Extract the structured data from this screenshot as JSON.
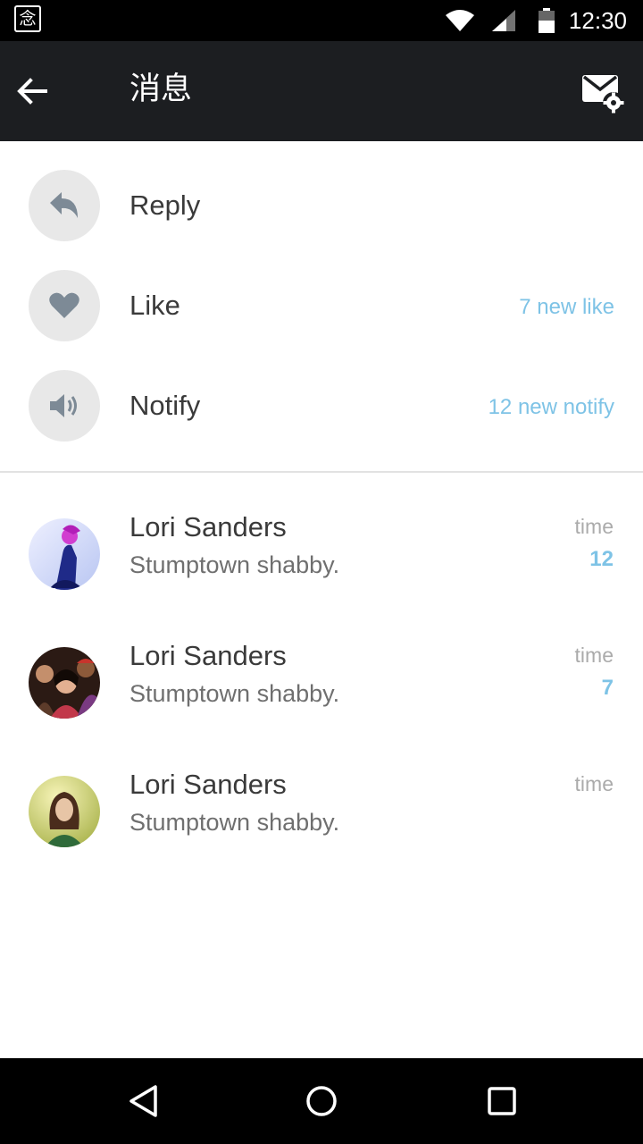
{
  "status_bar": {
    "app_badge": "念",
    "time": "12:30",
    "icons": [
      "wifi-icon",
      "cell-signal-icon",
      "battery-icon"
    ]
  },
  "app_bar": {
    "title": "消息",
    "back_icon": "arrow-left-icon",
    "action_icon": "mail-settings-icon"
  },
  "categories": [
    {
      "label": "Reply",
      "icon": "reply-icon",
      "count_text": ""
    },
    {
      "label": "Like",
      "icon": "heart-icon",
      "count_text": "7 new like"
    },
    {
      "label": "Notify",
      "icon": "speaker-icon",
      "count_text": "12 new notify"
    }
  ],
  "messages": [
    {
      "name": "Lori Sanders",
      "text": "Stumptown shabby.",
      "time": "time",
      "count": "12"
    },
    {
      "name": "Lori Sanders",
      "text": "Stumptown shabby.",
      "time": "time",
      "count": "7"
    },
    {
      "name": "Lori Sanders",
      "text": "Stumptown shabby.",
      "time": "time",
      "count": ""
    }
  ],
  "nav_bar": {
    "icons": [
      "back-triangle-icon",
      "home-circle-icon",
      "recents-square-icon"
    ]
  },
  "colors": {
    "accent": "#7ec3e6",
    "app_bar": "#1c1e21",
    "icon_circle": "#e8e8e8",
    "icon_gray": "#7d8a96"
  }
}
